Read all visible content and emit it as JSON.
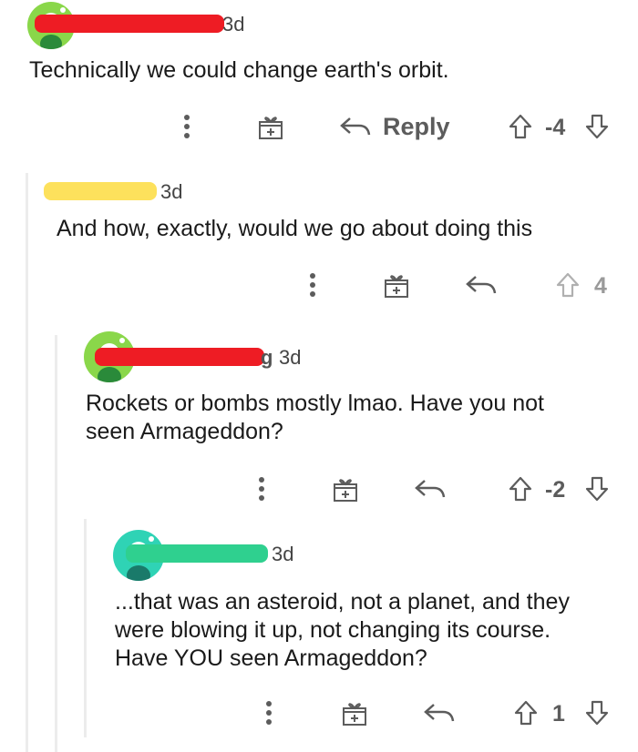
{
  "colors": {
    "background": "#ffffff",
    "thread_line": "#ececec",
    "icon": "#5c5c5c",
    "redact_red": "#ee1c24",
    "redact_yellow": "#fde15c",
    "redact_green": "#2fd08f",
    "avatar_green": "#8ad74a",
    "avatar_teal": "#2fd3b5"
  },
  "comments": [
    {
      "time": "3d",
      "body": "Technically we could change earth's orbit.",
      "reply_label": "Reply",
      "vote_count": "-4"
    },
    {
      "time": "3d",
      "body": "And how, exactly, would we go about doing this",
      "vote_count": "4"
    },
    {
      "time": "3d",
      "username_visible_fragment": "g",
      "body_lines": [
        "Rockets or bombs mostly lmao. Have you not",
        "seen Armageddon?"
      ],
      "vote_count": "-2"
    },
    {
      "time": "3d",
      "body_lines": [
        "...that was an asteroid, not a planet, and they",
        "were blowing it up, not changing its course.",
        "Have YOU seen Armageddon?"
      ],
      "vote_count": "1"
    }
  ],
  "icons": [
    "more-options-icon",
    "award-icon",
    "reply-icon",
    "upvote-icon",
    "downvote-icon"
  ]
}
